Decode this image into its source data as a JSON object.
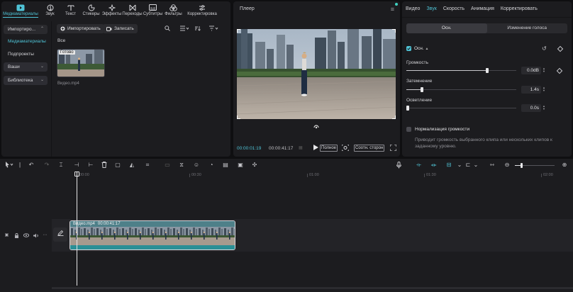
{
  "toolbar": {
    "items": [
      {
        "label": "Медиаматериалы",
        "icon": "media-icon"
      },
      {
        "label": "Звук",
        "icon": "audio-icon"
      },
      {
        "label": "Текст",
        "icon": "text-icon"
      },
      {
        "label": "Стикеры",
        "icon": "sticker-icon"
      },
      {
        "label": "Эффекты",
        "icon": "effects-icon"
      },
      {
        "label": "Переходы",
        "icon": "transitions-icon"
      },
      {
        "label": "Субтитры",
        "icon": "subtitles-icon"
      },
      {
        "label": "Фильтры",
        "icon": "filters-icon"
      },
      {
        "label": "Корректировка",
        "icon": "adjust-icon"
      }
    ]
  },
  "sidebar": {
    "import_dropdown": "Импортиро...",
    "media": "Медиаматериалы",
    "subprojects": "Подпроекты",
    "yours": "Ваши",
    "library": "Библиотека"
  },
  "media": {
    "import_button": "Импортировать",
    "record_button": "Записать",
    "all_label": "Все",
    "thumb_badge": "Готово",
    "thumb_name": "Видео.mp4"
  },
  "player": {
    "title": "Плеер",
    "current_time": "00:00:01:19",
    "duration": "00:00:41:17",
    "full_label": "Полное",
    "ratio_label": "Соотн. сторон"
  },
  "inspector": {
    "tabs": [
      "Видео",
      "Звук",
      "Скорость",
      "Анимация",
      "Корректировать"
    ],
    "active_tab": 1,
    "segments": [
      "Осн.",
      "Изменение голоса"
    ],
    "basic_label": "Осн.",
    "volume_label": "Громкость",
    "volume_value": "0.0dB",
    "fade_in_label": "Затемнение",
    "fade_in_value": "1.4s",
    "fade_out_label": "Осветление",
    "fade_out_value": "0.0s",
    "normalize_label": "Нормализация громкости",
    "normalize_desc": "Приводит громкость выбранного клипа или нескольких клипов к заданному уровню."
  },
  "timeline": {
    "ticks": [
      "00:00",
      "00:30",
      "01:00",
      "01:30",
      "02:00"
    ],
    "clip_name": "Видео.mp4",
    "clip_duration": "00:00:41:17"
  },
  "colors": {
    "accent": "#4fc3d6",
    "panel": "#1c1c1f",
    "clip": "#1e6e74"
  }
}
